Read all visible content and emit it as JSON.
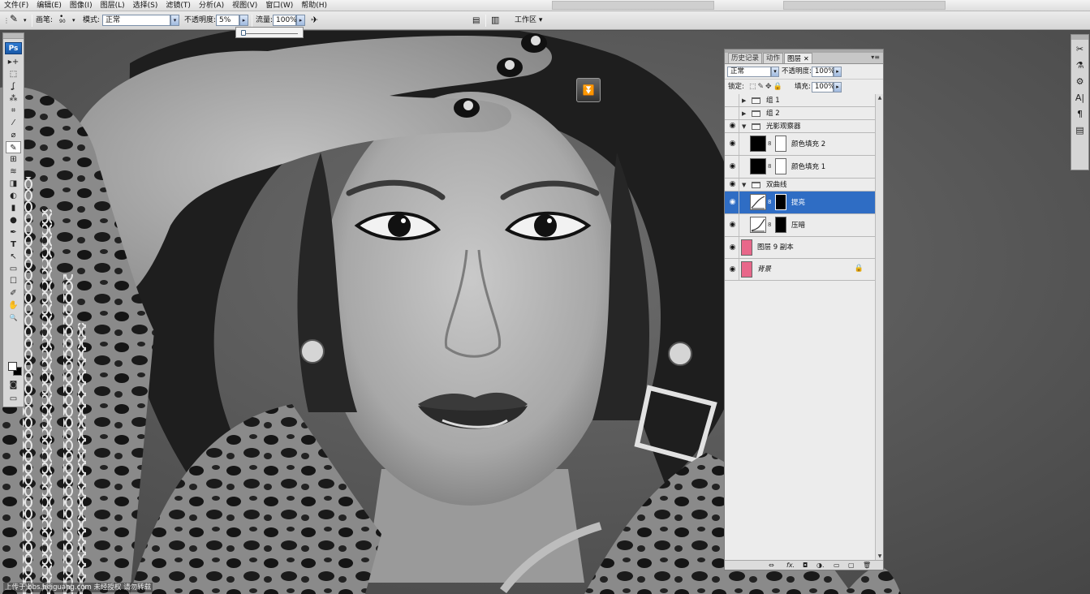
{
  "menubar": {
    "items": [
      "文件(F)",
      "编辑(E)",
      "图像(I)",
      "图层(L)",
      "选择(S)",
      "滤镜(T)",
      "分析(A)",
      "视图(V)",
      "窗口(W)",
      "帮助(H)"
    ]
  },
  "options": {
    "brush_label": "画笔:",
    "brush_size": "90",
    "mode_label": "模式:",
    "mode_value": "正常",
    "opacity_label": "不透明度:",
    "opacity_value": "5%",
    "flow_label": "流量:",
    "flow_value": "100%",
    "workspace_label": "工作区 ▾"
  },
  "toolbox": {
    "logo": "Ps",
    "tools": [
      "▸+",
      "⬚",
      "ʆ",
      "⁂",
      "⌗",
      "⁄",
      "⌀",
      "✎",
      "⊞",
      "≋",
      "◨",
      "◐",
      "▮",
      "●",
      "✒",
      "T",
      "↖",
      "▭",
      "☐",
      "✐",
      "✋",
      "🔍"
    ]
  },
  "panel": {
    "tabs": [
      "历史记录",
      "动作",
      "图层"
    ],
    "blend_mode": "正常",
    "opacity_label": "不透明度:",
    "opacity_value": "100%",
    "lock_label": "锁定:",
    "fill_label": "填充:",
    "fill_value": "100%",
    "menu_icon": "▾≡",
    "layers": [
      {
        "name": "组 1"
      },
      {
        "name": "组 2"
      },
      {
        "name": "光影观察器"
      },
      {
        "name": "颜色填充 2"
      },
      {
        "name": "颜色填充 1"
      },
      {
        "name": "双曲线"
      },
      {
        "name": "提亮"
      },
      {
        "name": "压暗"
      },
      {
        "name": "图层 9 副本"
      },
      {
        "name": "背景"
      }
    ],
    "footer_icons": [
      "⇔",
      "fx.",
      "◘",
      "◑.",
      "▭",
      "▢",
      "🗑"
    ]
  },
  "watermark": "上传于 bbs.heiguang.com 未经授权 请勿转载"
}
